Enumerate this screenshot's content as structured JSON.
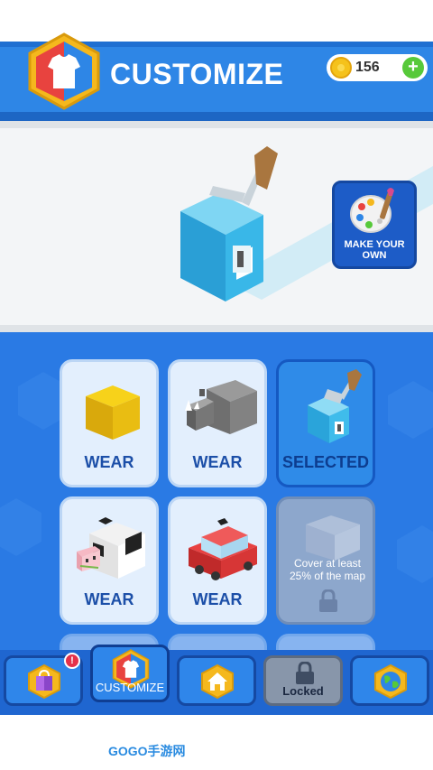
{
  "header": {
    "title": "CUSTOMIZE",
    "coins": "156",
    "plus_label": "+"
  },
  "preview": {
    "make_own_line1": "MAKE YOUR",
    "make_own_line2": "OWN"
  },
  "skins": [
    {
      "label": "WEAR",
      "icon": "yellow-cube-icon"
    },
    {
      "label": "WEAR",
      "icon": "rhino-icon"
    },
    {
      "label": "SELECTED",
      "icon": "paint-roller-cube-icon"
    },
    {
      "label": "WEAR",
      "icon": "cow-icon"
    },
    {
      "label": "WEAR",
      "icon": "red-car-icon"
    },
    {
      "label": "Cover at least 25% of the map",
      "icon": "lock-icon",
      "locked": true
    }
  ],
  "nav": {
    "badge": "!",
    "customize_label": "CUSTOMIZE",
    "locked_label": "Locked"
  },
  "watermark": "GOGO手游网",
  "colors": {
    "header_blue": "#2e86e6",
    "grid_blue": "#2a7ae4",
    "card_bg": "#e3effd",
    "label_blue": "#1c4fa8",
    "coin_gold": "#f5c21b",
    "plus_green": "#57c93a",
    "badge_red": "#e5314a"
  }
}
